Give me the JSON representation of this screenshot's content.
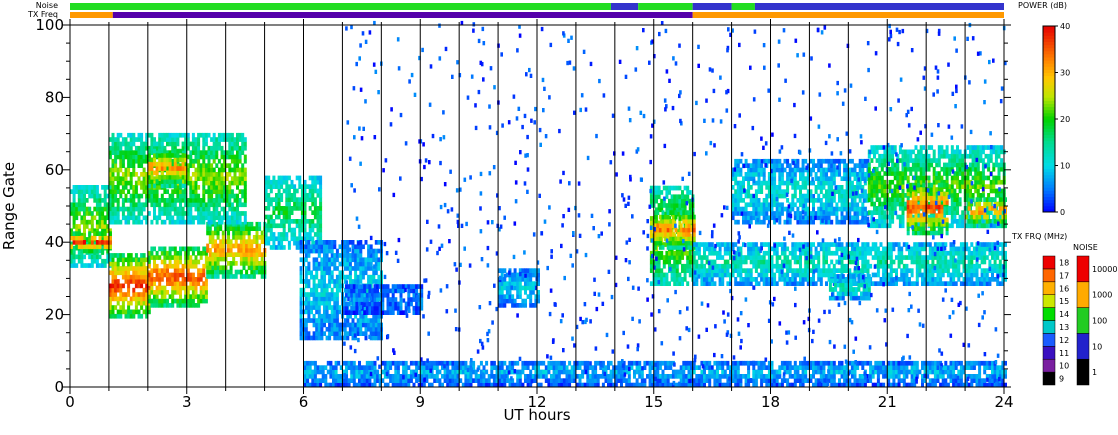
{
  "chart_data": {
    "type": "heatmap",
    "xlabel": "UT hours",
    "ylabel": "Range Gate",
    "xlim": [
      0,
      24
    ],
    "ylim": [
      0,
      100
    ],
    "x_ticks": [
      0,
      3,
      6,
      9,
      12,
      15,
      18,
      21,
      24
    ],
    "y_ticks": [
      0,
      20,
      40,
      60,
      80,
      100
    ],
    "grid": "vertical lines every hour",
    "status_bars": {
      "noise_label": "Noise",
      "txfreq_label": "TX Freq",
      "noise_segments": [
        {
          "start": 0,
          "end": 13.9,
          "color": "#22dd22"
        },
        {
          "start": 13.9,
          "end": 14.6,
          "color": "#3333cc"
        },
        {
          "start": 14.6,
          "end": 16.0,
          "color": "#22dd22"
        },
        {
          "start": 16.0,
          "end": 17.0,
          "color": "#3333cc"
        },
        {
          "start": 17.0,
          "end": 17.6,
          "color": "#22dd22"
        },
        {
          "start": 17.6,
          "end": 24.0,
          "color": "#3333cc"
        }
      ],
      "txfreq_segments": [
        {
          "start": 0,
          "end": 1.1,
          "color": "#ff9900"
        },
        {
          "start": 1.1,
          "end": 16.0,
          "color": "#5500aa"
        },
        {
          "start": 16.0,
          "end": 24.0,
          "color": "#ff9900"
        }
      ]
    },
    "power_colorbar": {
      "title": "POWER (dB)",
      "range": [
        0,
        40
      ],
      "ticks": [
        0,
        10,
        20,
        30,
        40
      ]
    },
    "txfreq_colorbar": {
      "title": "TX FRQ (MHz)",
      "labels": [
        "9",
        "10",
        "11",
        "12",
        "13",
        "14",
        "15",
        "16",
        "17",
        "18"
      ],
      "colors": [
        "#000000",
        "#7a1fa0",
        "#3a10c0",
        "#1a5cff",
        "#00c8c8",
        "#00dd00",
        "#cce800",
        "#ffb000",
        "#ff6600",
        "#ee0000"
      ]
    },
    "noise_colorbar": {
      "title": "NOISE",
      "labels": [
        "1",
        "10",
        "100",
        "1000",
        "10000"
      ],
      "colors": [
        "#000000",
        "#2222cc",
        "#22cc22",
        "#ffaa00",
        "#ee0000"
      ]
    },
    "echo_regions": [
      {
        "x0": 0.0,
        "x1": 1.0,
        "g0": 33,
        "g1": 55,
        "peak": 24
      },
      {
        "x0": 0.0,
        "x1": 1.0,
        "g0": 37,
        "g1": 42,
        "peak": 38
      },
      {
        "x0": 1.0,
        "x1": 2.0,
        "g0": 19,
        "g1": 36,
        "peak": 38
      },
      {
        "x0": 2.0,
        "x1": 3.5,
        "g0": 22,
        "g1": 38,
        "peak": 36
      },
      {
        "x0": 3.5,
        "x1": 5.0,
        "g0": 30,
        "g1": 45,
        "peak": 32
      },
      {
        "x0": 5.0,
        "x1": 6.4,
        "g0": 38,
        "g1": 58,
        "peak": 18
      },
      {
        "x0": 1.0,
        "x1": 4.5,
        "g0": 45,
        "g1": 70,
        "peak": 24
      },
      {
        "x0": 2.0,
        "x1": 3.0,
        "g0": 55,
        "g1": 65,
        "peak": 32
      },
      {
        "x0": 5.9,
        "x1": 8.0,
        "g0": 13,
        "g1": 40,
        "peak": 10
      },
      {
        "x0": 7.0,
        "x1": 9.0,
        "g0": 20,
        "g1": 28,
        "peak": 6
      },
      {
        "x0": 11.0,
        "x1": 12.0,
        "g0": 22,
        "g1": 32,
        "peak": 10
      },
      {
        "x0": 14.9,
        "x1": 16.0,
        "g0": 28,
        "g1": 55,
        "peak": 26
      },
      {
        "x0": 15.0,
        "x1": 16.0,
        "g0": 38,
        "g1": 48,
        "peak": 34
      },
      {
        "x0": 16.0,
        "x1": 24.0,
        "g0": 28,
        "g1": 40,
        "peak": 14
      },
      {
        "x0": 17.0,
        "x1": 20.5,
        "g0": 45,
        "g1": 62,
        "peak": 12
      },
      {
        "x0": 19.5,
        "x1": 20.5,
        "g0": 24,
        "g1": 30,
        "peak": 14
      },
      {
        "x0": 20.5,
        "x1": 24.0,
        "g0": 44,
        "g1": 66,
        "peak": 22
      },
      {
        "x0": 21.5,
        "x1": 22.5,
        "g0": 42,
        "g1": 56,
        "peak": 36
      },
      {
        "x0": 23.0,
        "x1": 24.0,
        "g0": 44,
        "g1": 52,
        "peak": 32
      },
      {
        "x0": 6.0,
        "x1": 24.0,
        "g0": 0,
        "g1": 7,
        "peak": 8
      }
    ]
  }
}
